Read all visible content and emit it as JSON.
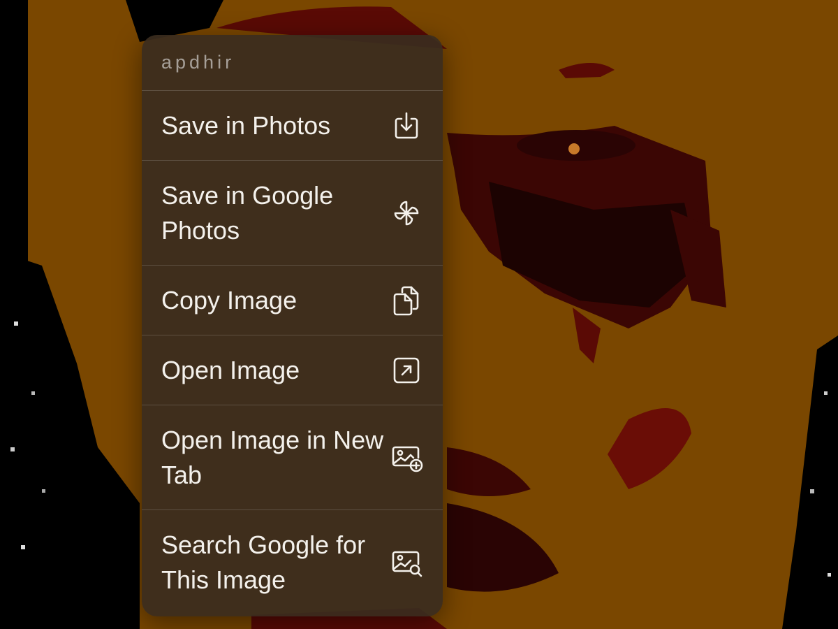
{
  "menu": {
    "title": "apdhir",
    "items": [
      {
        "label": "Save in Photos",
        "icon": "save-download-icon"
      },
      {
        "label": "Save in Google Photos",
        "icon": "google-photos-pinwheel-icon"
      },
      {
        "label": "Copy Image",
        "icon": "copy-document-icon"
      },
      {
        "label": "Open Image",
        "icon": "open-external-arrow-icon"
      },
      {
        "label": "Open Image in New Tab",
        "icon": "image-plus-icon"
      },
      {
        "label": "Search Google for This Image",
        "icon": "image-search-icon"
      }
    ]
  },
  "colors": {
    "background_orange": "#7a4700",
    "background_dark_red": "#5a0a05",
    "background_black": "#000000",
    "menu_background": "#3a2c1e",
    "menu_text": "#f4f1ec",
    "menu_header_text": "#9a948d"
  }
}
